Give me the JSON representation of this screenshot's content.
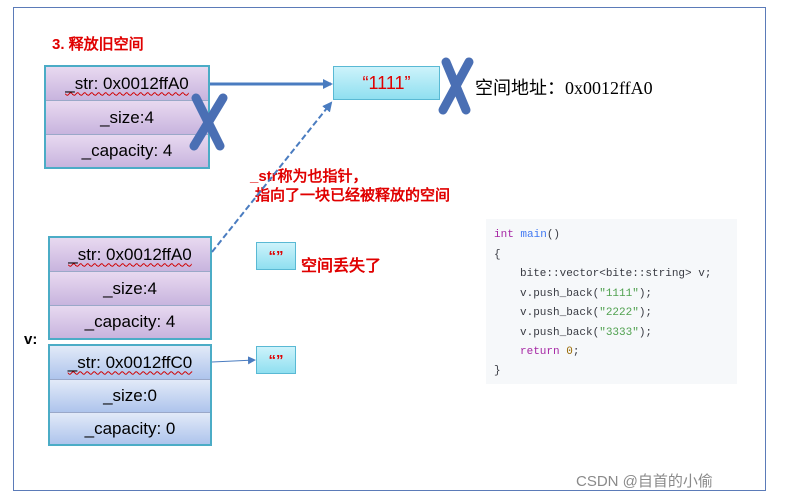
{
  "title": "3. 释放旧空间",
  "old_buffer": {
    "str": "_str: 0x0012ffA0",
    "size": "_size:4",
    "capacity": "_capacity: 4"
  },
  "v_elem0": {
    "str": "_str: 0x0012ffA0",
    "size": "_size:4",
    "capacity": "_capacity: 4"
  },
  "v_elem1": {
    "str": "_str: 0x0012ffC0",
    "size": "_size:0",
    "capacity": "_capacity: 0"
  },
  "v_label": "v:",
  "freed_string": "“1111”",
  "space_address": "空间地址：0x0012ffA0",
  "dangling_note_line1": "_str称为也指针，",
  "dangling_note_line2": "指向了一块已经被释放的空间",
  "lost_string": "“”",
  "lost_note": "空间丢失了",
  "empty_string": "“”",
  "code": {
    "line1_kw": "int",
    "line1_fn": "main",
    "line1_rest": "()",
    "line2": "{",
    "line3": "bite::vector<bite::string> v;",
    "line4_a": "v.push_back(",
    "line4_s": "\"1111\"",
    "line4_b": ");",
    "line5_a": "v.push_back(",
    "line5_s": "\"2222\"",
    "line5_b": ");",
    "line6_a": "v.push_back(",
    "line6_s": "\"3333\"",
    "line6_b": ");",
    "line7_kw": "return",
    "line7_num": "0",
    "line7_b": ";",
    "line8": "}"
  },
  "watermark": "CSDN @自首的小偷",
  "colors": {
    "red_text": "#e00000",
    "cross": "#4a6fb4",
    "arrow": "#4a7cc0",
    "cell_border": "#4bacc6"
  }
}
